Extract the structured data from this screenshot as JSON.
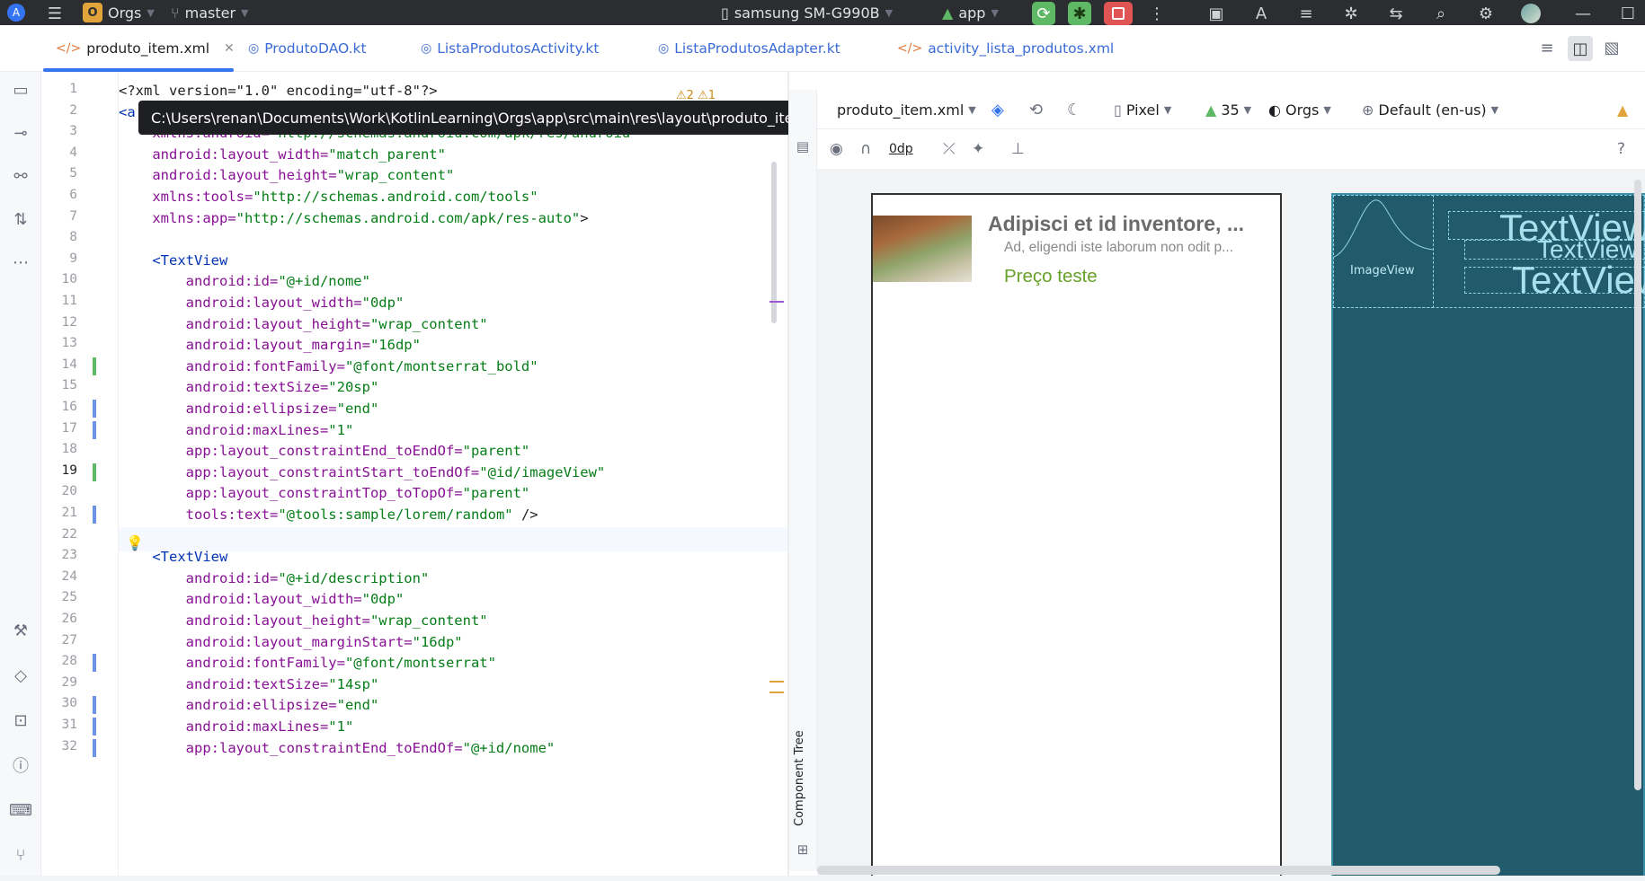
{
  "topbar": {
    "project_letter": "O",
    "project_name": "Orgs",
    "branch": "master",
    "device": "samsung SM-G990B",
    "run_config": "app"
  },
  "tabs": [
    {
      "label": "produto_item.xml",
      "active": true
    },
    {
      "label": "ProdutoDAO.kt"
    },
    {
      "label": "ListaProdutosActivity.kt"
    },
    {
      "label": "ListaProdutosAdapter.kt"
    },
    {
      "label": "activity_lista_produtos.xml"
    }
  ],
  "tooltip": "C:\\Users\\renan\\Documents\\Work\\KotlinLearning\\Orgs\\app\\src\\main\\res\\layout\\produto_item.xml",
  "editor": {
    "line_numbers": [
      "1",
      "2",
      "3",
      "4",
      "5",
      "6",
      "7",
      "8",
      "9",
      "10",
      "11",
      "12",
      "13",
      "14",
      "15",
      "16",
      "17",
      "18",
      "19",
      "20",
      "21",
      "22",
      "23",
      "24",
      "25",
      "26",
      "27",
      "28",
      "29",
      "30",
      "31",
      "32"
    ],
    "inspection_counts": {
      "warnings": "2",
      "weak_warnings": "1"
    },
    "lines": [
      [
        "<?xml version=\"1.0\" encoding=\"utf-8\"?>"
      ],
      [
        "<a"
      ],
      [
        "    xmlns:android=",
        "\"http://schemas.android.com/apk/res/android\""
      ],
      [
        "    android:layout_width=",
        "\"match_parent\""
      ],
      [
        "    android:layout_height=",
        "\"wrap_content\""
      ],
      [
        "    xmlns:tools=",
        "\"http://schemas.android.com/tools\""
      ],
      [
        "    xmlns:app=",
        "\"http://schemas.android.com/apk/res-auto\"",
        ">"
      ],
      [
        ""
      ],
      [
        "    <TextView"
      ],
      [
        "        android:id=",
        "\"@+id/nome\""
      ],
      [
        "        android:layout_width=",
        "\"0dp\""
      ],
      [
        "        android:layout_height=",
        "\"wrap_content\""
      ],
      [
        "        android:layout_margin=",
        "\"16dp\""
      ],
      [
        "        android:fontFamily=",
        "\"@font/montserrat_bold\""
      ],
      [
        "        android:textSize=",
        "\"20sp\""
      ],
      [
        "        android:ellipsize=",
        "\"end\""
      ],
      [
        "        android:maxLines=",
        "\"1\""
      ],
      [
        "        app:layout_constraintEnd_toEndOf=",
        "\"parent\""
      ],
      [
        "        app:layout_constraintStart_toEndOf=",
        "\"@id/imageView\""
      ],
      [
        "        app:layout_constraintTop_toTopOf=",
        "\"parent\""
      ],
      [
        "        tools:text=",
        "\"@tools:sample/lorem/random\"",
        " />"
      ],
      [
        ""
      ],
      [
        "    <TextView"
      ],
      [
        "        android:id=",
        "\"@+id/description\""
      ],
      [
        "        android:layout_width=",
        "\"0dp\""
      ],
      [
        "        android:layout_height=",
        "\"wrap_content\""
      ],
      [
        "        android:layout_marginStart=",
        "\"16dp\""
      ],
      [
        "        android:fontFamily=",
        "\"@font/montserrat\""
      ],
      [
        "        android:textSize=",
        "\"14sp\""
      ],
      [
        "        android:ellipsize=",
        "\"end\""
      ],
      [
        "        android:maxLines=",
        "\"1\""
      ],
      [
        "        app:layout_constraintEnd_toEndOf=",
        "\"@+id/nome\""
      ]
    ]
  },
  "design_toolbar": {
    "file": "produto_item.xml",
    "device": "Pixel",
    "api": "35",
    "theme": "Orgs",
    "locale": "Default (en-us)",
    "margin": "0dp"
  },
  "preview": {
    "title": "Adipisci et id inventore, ...",
    "description": "Ad, eligendi iste laborum non odit p...",
    "price": "Preço teste"
  },
  "blueprint": {
    "image_label": "ImageView",
    "text_label": "TextView"
  },
  "side_panel": {
    "component_tree": "Component Tree"
  },
  "colors": {
    "accent": "#3574f0",
    "price": "#67a02a",
    "blueprint": "#215a6b"
  }
}
